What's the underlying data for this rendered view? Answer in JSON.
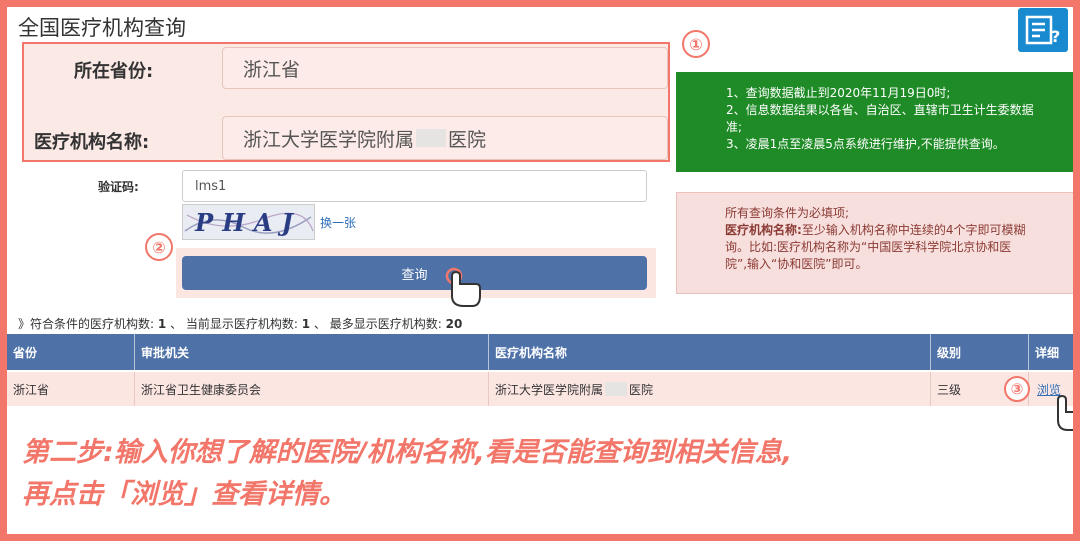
{
  "page": {
    "title": "全国医疗机构查询"
  },
  "markers": {
    "one": "①",
    "two": "②",
    "three": "③"
  },
  "form": {
    "province_label": "所在省份:",
    "province_value": "浙江省",
    "institution_label": "医疗机构名称:",
    "institution_value_prefix": "浙江大学医学院附属",
    "institution_value_suffix": "医院",
    "captcha_label": "验证码:",
    "captcha_input_value": "lms1",
    "captcha_image_text": "PHAJ",
    "captcha_refresh": "换一张",
    "submit_label": "查询"
  },
  "notice_green": {
    "line1": "1、查询数据截止到2020年11月19日0时;",
    "line2": "2、信息数据结果以各省、自治区、直辖市卫生计生委数据",
    "line3": "准;",
    "line4": "3、凌晨1点至凌晨5点系统进行维护,不能提供查询。"
  },
  "notice_pink": {
    "line1": "所有查询条件为必填项;",
    "line2_bold": "医疗机构名称:",
    "line2": "至少输入机构名称中连续的4个字即可模糊",
    "line3": "询。比如:医疗机构名称为“中国医学科学院北京协和医",
    "line4": "院”,输入“协和医院”即可。"
  },
  "summary": {
    "prefix": "》符合条件的医疗机构数:",
    "matched": "1",
    "sep1": "、 当前显示医疗机构数:",
    "shown": "1",
    "sep2": "、 最多显示医疗机构数:",
    "max": "20"
  },
  "table": {
    "headers": [
      "省份",
      "审批机关",
      "医疗机构名称",
      "级别",
      "详细"
    ],
    "rows": [
      {
        "province": "浙江省",
        "authority": "浙江省卫生健康委员会",
        "name_prefix": "浙江大学医学院附属",
        "name_suffix": "医院",
        "level": "三级",
        "detail": "浏览"
      }
    ]
  },
  "caption": {
    "line1": "第二步:输入你想了解的医院/机构名称,看是否能查询到相关信息,",
    "line2": "再点击「浏览」查看详情。"
  },
  "colors": {
    "accent": "#f2766a",
    "table_header": "#4e72a8",
    "notice_green": "#1f8b27"
  }
}
